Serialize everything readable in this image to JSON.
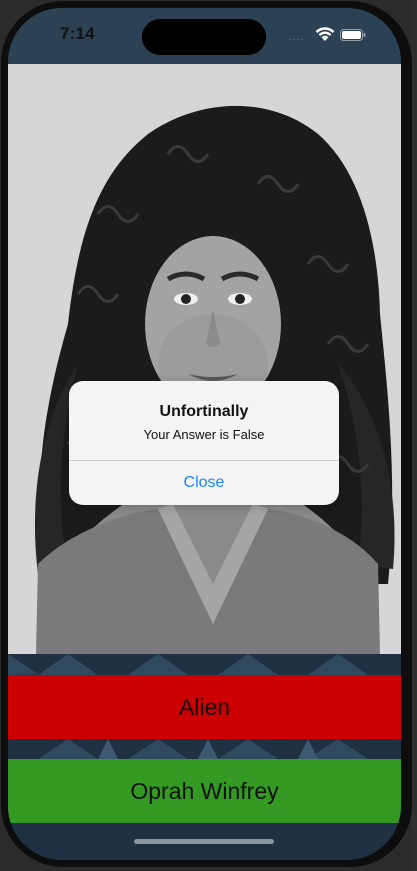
{
  "status_bar": {
    "time": "7:14",
    "signal_dots": "....",
    "wifi_icon": "wifi-icon",
    "battery_icon": "battery-icon"
  },
  "photo": {
    "icon": "portrait-photo"
  },
  "alert": {
    "title": "Unfortinally",
    "message": "Your Answer is False",
    "close_label": "Close"
  },
  "answers": [
    {
      "label": "Alien",
      "color": "#cc0000"
    },
    {
      "label": "Oprah Winfrey",
      "color": "#339922"
    }
  ],
  "colors": {
    "status_bar": "#2a4253",
    "pattern_bg": "#1e3142",
    "photo_bg": "#d9d9d9",
    "alert_link": "#1a84ff"
  }
}
